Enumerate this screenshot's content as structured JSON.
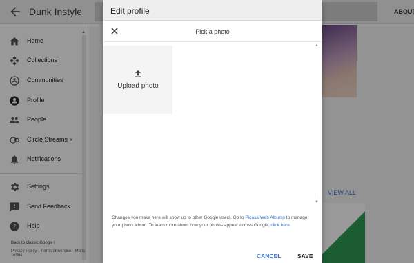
{
  "app": {
    "title": "Dunk Instyle",
    "about_label": "ABOUT"
  },
  "sidebar": {
    "items": [
      {
        "label": "Home",
        "icon": "home-icon"
      },
      {
        "label": "Collections",
        "icon": "collections-icon"
      },
      {
        "label": "Communities",
        "icon": "communities-icon"
      },
      {
        "label": "Profile",
        "icon": "profile-icon"
      },
      {
        "label": "People",
        "icon": "people-icon"
      },
      {
        "label": "Circle Streams",
        "icon": "circle-streams-icon"
      },
      {
        "label": "Notifications",
        "icon": "bell-icon"
      },
      {
        "label": "Settings",
        "icon": "gear-icon"
      },
      {
        "label": "Send Feedback",
        "icon": "feedback-icon"
      },
      {
        "label": "Help",
        "icon": "help-icon"
      }
    ],
    "classic_link": "Back to classic Google+",
    "policy_link": "Privacy Policy · Terms of Service · Maps Terms"
  },
  "content": {
    "view_all": "VIEW ALL"
  },
  "dialog": {
    "title": "Edit profile",
    "picker_title": "Pick a photo",
    "upload_label": "Upload photo",
    "info_before": "Changes you make here will show up to other Google users. Go to ",
    "info_link1": "Picasa Web Albums",
    "info_middle": " to manage your photo album. To learn more about how your photos appear across Google, ",
    "info_link2": "click here",
    "info_after": ".",
    "cancel_label": "CANCEL",
    "save_label": "SAVE"
  },
  "colors": {
    "accent": "#3b77d6",
    "green_card": "#2e9a55"
  }
}
